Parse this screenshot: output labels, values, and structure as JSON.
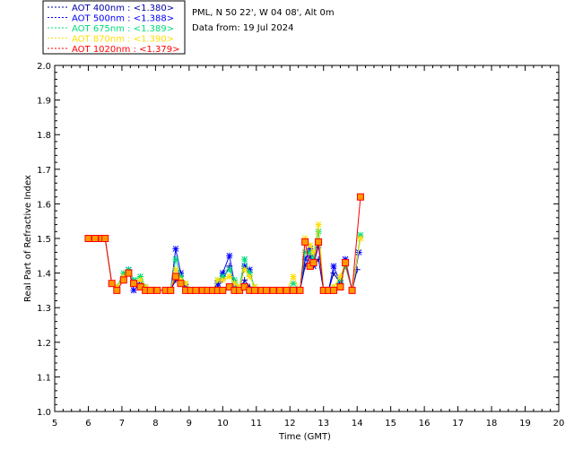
{
  "chart_data": {
    "type": "line",
    "site": "PML, N 50 22', W 04 08', Alt 0m",
    "date_line": "Data from: 19 Jul 2024",
    "xlabel": "Time (GMT)",
    "ylabel": "Real Part of Refractive Index",
    "xlim": [
      5,
      20
    ],
    "ylim": [
      1.0,
      2.0
    ],
    "xticks": [
      "5",
      "6",
      "7",
      "8",
      "9",
      "10",
      "11",
      "12",
      "13",
      "14",
      "15",
      "16",
      "17",
      "18",
      "19",
      "20"
    ],
    "yticks": [
      "1.0",
      "1.1",
      "1.2",
      "1.3",
      "1.4",
      "1.5",
      "1.6",
      "1.7",
      "1.8",
      "1.9",
      "2.0"
    ],
    "legend_position": "top-left outside",
    "series": [
      {
        "name": "AOT  400nm : <1.380>",
        "color": "#0000aa",
        "marker": "plus",
        "x": [
          6.0,
          6.2,
          6.4,
          6.5,
          6.7,
          6.85,
          7.05,
          7.2,
          7.35,
          7.55,
          7.7,
          7.85,
          8.05,
          8.3,
          8.45,
          8.6,
          8.75,
          8.9,
          9.05,
          9.2,
          9.4,
          9.55,
          9.7,
          9.85,
          10.0,
          10.2,
          10.35,
          10.5,
          10.65,
          10.8,
          10.95,
          11.15,
          11.3,
          11.5,
          11.7,
          11.9,
          12.1,
          12.3,
          12.45,
          12.6,
          12.7,
          12.85,
          13.0,
          13.15,
          13.3,
          13.5,
          13.65,
          13.85,
          14.0
        ],
        "y": [
          1.5,
          1.5,
          1.5,
          1.5,
          1.37,
          1.36,
          1.39,
          1.4,
          1.37,
          1.37,
          1.36,
          1.35,
          1.35,
          1.35,
          1.35,
          1.38,
          1.37,
          1.36,
          1.35,
          1.35,
          1.35,
          1.35,
          1.35,
          1.36,
          1.38,
          1.42,
          1.36,
          1.35,
          1.38,
          1.36,
          1.35,
          1.35,
          1.35,
          1.35,
          1.35,
          1.35,
          1.35,
          1.35,
          1.42,
          1.45,
          1.42,
          1.44,
          1.35,
          1.35,
          1.4,
          1.37,
          1.43,
          1.35,
          1.41
        ]
      },
      {
        "name": "AOT  500nm : <1.388>",
        "color": "#0000ff",
        "marker": "star",
        "x": [
          6.0,
          6.2,
          6.4,
          6.5,
          6.7,
          6.85,
          7.05,
          7.2,
          7.35,
          7.55,
          7.7,
          7.85,
          8.05,
          8.3,
          8.45,
          8.6,
          8.75,
          8.9,
          9.05,
          9.2,
          9.4,
          9.55,
          9.7,
          9.85,
          10.0,
          10.2,
          10.35,
          10.5,
          10.65,
          10.8,
          10.95,
          11.15,
          11.3,
          11.5,
          11.7,
          11.9,
          12.1,
          12.3,
          12.45,
          12.6,
          12.7,
          12.85,
          13.0,
          13.15,
          13.3,
          13.5,
          13.65,
          13.85,
          14.05
        ],
        "y": [
          1.5,
          1.5,
          1.5,
          1.5,
          1.37,
          1.36,
          1.39,
          1.41,
          1.35,
          1.37,
          1.36,
          1.35,
          1.35,
          1.35,
          1.35,
          1.47,
          1.4,
          1.36,
          1.35,
          1.35,
          1.35,
          1.35,
          1.35,
          1.37,
          1.4,
          1.45,
          1.37,
          1.35,
          1.42,
          1.41,
          1.35,
          1.35,
          1.35,
          1.35,
          1.35,
          1.35,
          1.35,
          1.35,
          1.44,
          1.47,
          1.42,
          1.48,
          1.35,
          1.35,
          1.42,
          1.37,
          1.44,
          1.35,
          1.46
        ]
      },
      {
        "name": "AOT  675nm : <1.389>",
        "color": "#00dd77",
        "marker": "star",
        "x": [
          6.0,
          6.2,
          6.4,
          6.5,
          6.7,
          6.85,
          7.05,
          7.2,
          7.35,
          7.55,
          7.7,
          7.85,
          8.05,
          8.3,
          8.45,
          8.6,
          8.75,
          8.9,
          9.05,
          9.2,
          9.4,
          9.55,
          9.7,
          9.85,
          10.0,
          10.2,
          10.35,
          10.5,
          10.65,
          10.8,
          10.95,
          11.15,
          11.3,
          11.5,
          11.7,
          11.9,
          12.1,
          12.3,
          12.45,
          12.6,
          12.7,
          12.85,
          13.0,
          13.15,
          13.3,
          13.5,
          13.65,
          13.85,
          14.1
        ],
        "y": [
          1.5,
          1.5,
          1.5,
          1.5,
          1.37,
          1.36,
          1.4,
          1.41,
          1.38,
          1.39,
          1.36,
          1.35,
          1.35,
          1.35,
          1.35,
          1.44,
          1.39,
          1.37,
          1.35,
          1.35,
          1.35,
          1.35,
          1.35,
          1.38,
          1.39,
          1.41,
          1.38,
          1.36,
          1.44,
          1.4,
          1.36,
          1.35,
          1.35,
          1.35,
          1.35,
          1.35,
          1.37,
          1.35,
          1.46,
          1.46,
          1.44,
          1.52,
          1.35,
          1.35,
          1.36,
          1.38,
          1.42,
          1.35,
          1.51
        ]
      },
      {
        "name": "AOT  870nm : <1.390>",
        "color": "#ffdd00",
        "marker": "star",
        "x": [
          6.0,
          6.2,
          6.4,
          6.5,
          6.7,
          6.85,
          7.05,
          7.2,
          7.35,
          7.55,
          7.7,
          7.85,
          8.05,
          8.3,
          8.45,
          8.6,
          8.75,
          8.9,
          9.05,
          9.2,
          9.4,
          9.55,
          9.7,
          9.85,
          10.0,
          10.2,
          10.35,
          10.5,
          10.65,
          10.8,
          10.95,
          11.15,
          11.3,
          11.5,
          11.7,
          11.9,
          12.1,
          12.3,
          12.45,
          12.6,
          12.7,
          12.85,
          13.0,
          13.15,
          13.3,
          13.5,
          13.65,
          13.85,
          14.1
        ],
        "y": [
          1.5,
          1.5,
          1.5,
          1.5,
          1.37,
          1.36,
          1.39,
          1.4,
          1.37,
          1.38,
          1.36,
          1.35,
          1.35,
          1.35,
          1.35,
          1.41,
          1.38,
          1.37,
          1.35,
          1.35,
          1.35,
          1.35,
          1.35,
          1.38,
          1.38,
          1.39,
          1.37,
          1.36,
          1.41,
          1.39,
          1.36,
          1.35,
          1.35,
          1.35,
          1.35,
          1.35,
          1.39,
          1.35,
          1.5,
          1.48,
          1.46,
          1.54,
          1.35,
          1.35,
          1.36,
          1.39,
          1.43,
          1.35,
          1.5
        ]
      },
      {
        "name": "AOT 1020nm : <1.379>",
        "color": "#ff0000",
        "marker": "square",
        "x": [
          6.0,
          6.2,
          6.4,
          6.5,
          6.7,
          6.85,
          7.05,
          7.2,
          7.35,
          7.55,
          7.7,
          7.85,
          8.05,
          8.3,
          8.45,
          8.6,
          8.75,
          8.9,
          9.05,
          9.2,
          9.4,
          9.55,
          9.7,
          9.85,
          10.0,
          10.2,
          10.35,
          10.5,
          10.65,
          10.8,
          10.95,
          11.15,
          11.3,
          11.5,
          11.7,
          11.9,
          12.1,
          12.3,
          12.45,
          12.6,
          12.7,
          12.85,
          13.0,
          13.15,
          13.3,
          13.5,
          13.65,
          13.85,
          14.1
        ],
        "y": [
          1.5,
          1.5,
          1.5,
          1.5,
          1.37,
          1.35,
          1.38,
          1.4,
          1.37,
          1.36,
          1.35,
          1.35,
          1.35,
          1.35,
          1.35,
          1.39,
          1.37,
          1.35,
          1.35,
          1.35,
          1.35,
          1.35,
          1.35,
          1.35,
          1.35,
          1.36,
          1.35,
          1.35,
          1.36,
          1.35,
          1.35,
          1.35,
          1.35,
          1.35,
          1.35,
          1.35,
          1.35,
          1.35,
          1.49,
          1.42,
          1.43,
          1.49,
          1.35,
          1.35,
          1.35,
          1.36,
          1.43,
          1.35,
          1.62
        ]
      }
    ]
  }
}
